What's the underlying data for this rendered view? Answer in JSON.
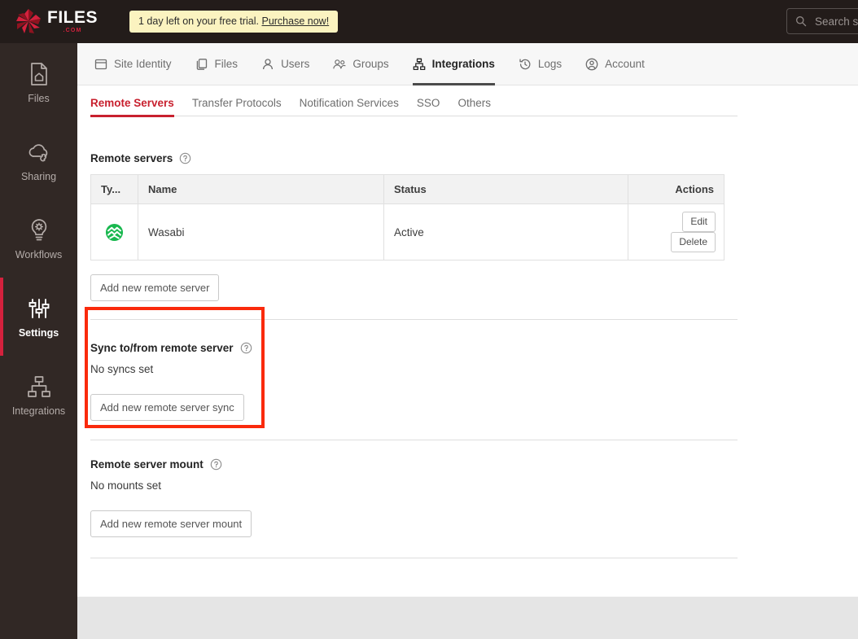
{
  "brand": {
    "logo_text": "FILES",
    "logo_suffix": ".COM",
    "accent_red": "#d4213d",
    "tab_active_red": "#c8202e",
    "annotation_red": "#fa2a0c",
    "wasabi_green": "#19b84f"
  },
  "topbar": {
    "trial_text": "1 day left on your free trial.",
    "trial_link": "Purchase now!",
    "search_placeholder": "Search s",
    "search_value": ""
  },
  "sidebar": {
    "items": [
      {
        "label": "Files",
        "icon": "file-home-icon",
        "active": false
      },
      {
        "label": "Sharing",
        "icon": "cloud-link-icon",
        "active": false
      },
      {
        "label": "Workflows",
        "icon": "lightbulb-gear-icon",
        "active": false
      },
      {
        "label": "Settings",
        "icon": "sliders-icon",
        "active": true
      },
      {
        "label": "Integrations",
        "icon": "sitemap-icon",
        "active": false
      }
    ]
  },
  "tabs": [
    {
      "label": "Site Identity",
      "icon": "window-icon",
      "active": false
    },
    {
      "label": "Files",
      "icon": "copy-icon",
      "active": false
    },
    {
      "label": "Users",
      "icon": "user-icon",
      "active": false
    },
    {
      "label": "Groups",
      "icon": "users-icon",
      "active": false
    },
    {
      "label": "Integrations",
      "icon": "sitemap-icon",
      "active": true
    },
    {
      "label": "Logs",
      "icon": "history-icon",
      "active": false
    },
    {
      "label": "Account",
      "icon": "account-circle-icon",
      "active": false
    }
  ],
  "subtabs": [
    {
      "label": "Remote Servers",
      "active": true
    },
    {
      "label": "Transfer Protocols",
      "active": false
    },
    {
      "label": "Notification Services",
      "active": false
    },
    {
      "label": "SSO",
      "active": false
    },
    {
      "label": "Others",
      "active": false
    }
  ],
  "remote_servers": {
    "heading": "Remote servers",
    "columns": [
      "Ty...",
      "Name",
      "Status",
      "Actions"
    ],
    "rows": [
      {
        "type_icon": "wasabi-logo",
        "name": "Wasabi",
        "status": "Active",
        "edit_label": "Edit",
        "delete_label": "Delete"
      }
    ],
    "add_button": "Add new remote server"
  },
  "sync_section": {
    "heading": "Sync to/from remote server",
    "empty_text": "No syncs set",
    "add_button": "Add new remote server sync",
    "highlighted": true
  },
  "mount_section": {
    "heading": "Remote server mount",
    "empty_text": "No mounts set",
    "add_button": "Add new remote server mount"
  }
}
